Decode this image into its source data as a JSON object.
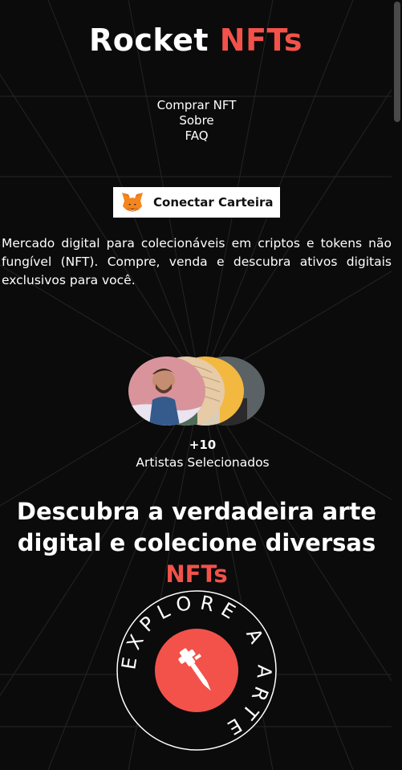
{
  "brand": {
    "title_prefix": "Rocket",
    "title_accent": "NFTs",
    "accent_color": "#f2524a"
  },
  "nav": {
    "items": [
      {
        "label": "Comprar NFT"
      },
      {
        "label": "Sobre"
      },
      {
        "label": "FAQ"
      }
    ]
  },
  "wallet_button": {
    "label": "Conectar Carteira",
    "icon": "metamask-fox-icon"
  },
  "hero": {
    "description": "Mercado digital para colecionáveis em criptos e tokens não fungível (NFT). Compre, venda e descubra ativos digitais exclusivos para você."
  },
  "artists": {
    "count": "+10",
    "label": "Artistas Selecionados"
  },
  "headline": {
    "text": "Descubra a verdadeira arte digital e colecione diversas",
    "accent": "NFTs"
  },
  "explore_badge": {
    "ring_text": "EXPLORE A ARTE",
    "icon": "tattoo-machine-icon"
  }
}
